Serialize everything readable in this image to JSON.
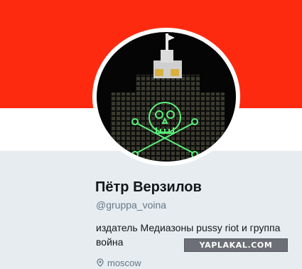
{
  "profile": {
    "name": "Пётр Верзилов",
    "handle": "@gruppa_voina",
    "bio": "издатель Медиазоны pussy riot и группа война",
    "location": "moscow"
  },
  "icons": {
    "avatar": "laser-skull-kremlin-image",
    "location": "location-pin-icon"
  },
  "watermark": "YAPLAKAL.COM",
  "colors": {
    "banner": "#fe2a10",
    "background": "#e6ecf0",
    "name": "#14171a",
    "secondary_text": "#657786"
  }
}
